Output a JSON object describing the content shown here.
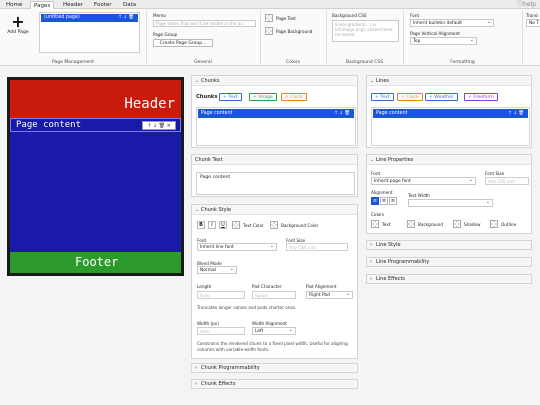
{
  "tabs": [
    "Home",
    "Pages",
    "Header",
    "Footer",
    "Data"
  ],
  "help_label": "help",
  "ribbon": {
    "add_page_label": "Add Page",
    "page_item": "(untitled page)",
    "page_item_icons": "↑ ↓ 🗑",
    "memo_label": "Memo",
    "memo_placeholder": "Page notes that won't be visible in the bu",
    "page_group_label": "Page Group",
    "create_page_group": "Create Page Group...",
    "page_text_label": "Page Text",
    "page_background_label": "Page Background",
    "bg_css_label": "Background CSS",
    "bg_css_placeholder": "linear-gradient(...) or url(image.png); center/cover no-repeat",
    "font_label": "Font",
    "font_value": "Inherit bulletin default",
    "page_vertical_alignment_label": "Page Vertical Alignment",
    "vertical_alignment_value": "Top",
    "transition_label": "Transi",
    "transition_value": "No T",
    "groups": [
      "Page Management",
      "General",
      "Colors",
      "Background CSS",
      "Formatting"
    ]
  },
  "preview": {
    "header": "Header",
    "content": "Page content",
    "tools": "↑ ↓ 🗑 ✕",
    "footer": "Footer"
  },
  "chunks": {
    "title": "Chunks",
    "heading": "Chunks",
    "add_text": "+ Text",
    "add_image": "+ Image",
    "add_clock": "+ Clock",
    "selected": "Page content",
    "selected_icons": "↑ ↓ 🗑"
  },
  "chunk_text": {
    "title": "Chunk Text",
    "value": "Page content"
  },
  "chunk_style": {
    "title": "Chunk Style",
    "bold": "B",
    "italic": "I",
    "underline": "U",
    "text_color": "Text Color",
    "background_color": "Background Color",
    "font_label": "Font",
    "font_value": "Inherit line font",
    "font_size_label": "Font Size",
    "font_size_placeholder": "Any CSS unit",
    "blend_mode_label": "Blend Mode",
    "blend_mode_value": "Normal",
    "length_label": "Length",
    "length_placeholder": "Auto",
    "pad_character_label": "Pad Character",
    "pad_character_placeholder": "Space",
    "pad_alignment_label": "Pad Alignment",
    "pad_alignment_value": "Right Pad",
    "length_help": "Truncates longer values and pads shorter ones.",
    "width_label": "Width (px)",
    "width_placeholder": "Auto",
    "width_alignment_label": "Width Alignment",
    "width_alignment_value": "Left",
    "width_help": "Constrains the rendered chunk to a fixed pixel width. Useful for aligning columns with variable-width fonts."
  },
  "chunk_programmability": "Chunk Programmability",
  "chunk_effects": "Chunk Effects",
  "lines": {
    "title": "Lines",
    "add_text": "+ Text",
    "add_clock": "+ Clock",
    "add_weather": "+ Weather",
    "add_freeform": "+ Freeform",
    "selected": "Page content",
    "selected_icons": "↑ ↓ 🗑"
  },
  "line_properties": {
    "title": "Line Properties",
    "font_label": "Font",
    "font_value": "Inherit page font",
    "font_size_label": "Font Size",
    "font_size_placeholder": "Any CSS unit",
    "alignment_label": "Alignment",
    "text_width_label": "Text Width",
    "colors_label": "Colors",
    "text": "Text",
    "background": "Background",
    "shadow": "Shadow",
    "outline": "Outline"
  },
  "line_style": "Line Style",
  "line_programmability": "Line Programmability",
  "line_effects": "Line Effects",
  "colors": {
    "accent": "#1a56d6",
    "header_bg": "#c81b0c",
    "body_bg": "#1a1aa8",
    "footer_bg": "#2c9a2c",
    "text_pill": "#2f6fd0",
    "image_pill": "#2e9a52",
    "clock_pill": "#e08a10",
    "weather_pill": "#2f6fd0",
    "freeform_pill": "#8a3fd0"
  }
}
